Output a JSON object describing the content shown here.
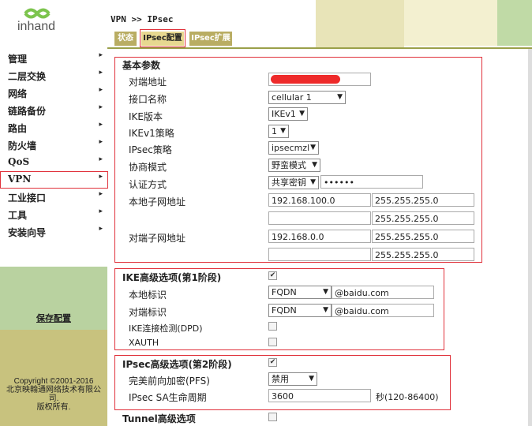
{
  "logo": {
    "text": "inhand"
  },
  "breadcrumb": "VPN >> IPsec",
  "tabs": [
    {
      "label": "状态"
    },
    {
      "label": "IPsec配置"
    },
    {
      "label": "IPsec扩展"
    }
  ],
  "menu": [
    {
      "label": "管理"
    },
    {
      "label": "二层交换"
    },
    {
      "label": "网络"
    },
    {
      "label": "链路备份"
    },
    {
      "label": "路由"
    },
    {
      "label": "防火墙"
    },
    {
      "label": "QoS"
    },
    {
      "label": "VPN"
    },
    {
      "label": "工业接口"
    },
    {
      "label": "工具"
    },
    {
      "label": "安装向导"
    }
  ],
  "menu_arrow": "▸",
  "save_config": "保存配置",
  "copyright": {
    "line1": "Copyright ©2001-2016",
    "line2": "北京映翰通网络技术有限公司.",
    "line3": "版权所有."
  },
  "basic": {
    "title": "基本参数",
    "peer_address_label": "对端地址",
    "interface_label": "接口名称",
    "interface_value": "cellular 1",
    "ike_version_label": "IKE版本",
    "ike_version_value": "IKEv1",
    "ikev1_policy_label": "IKEv1策略",
    "ikev1_policy_value": "1",
    "ipsec_policy_label": "IPsec策略",
    "ipsec_policy_value": "ipsecmzl",
    "negotiation_label": "协商模式",
    "negotiation_value": "野蛮模式",
    "auth_label": "认证方式",
    "auth_value": "共享密钥",
    "auth_secret": "••••••",
    "local_subnet_label": "本地子网地址",
    "local_subnet_ip": "192.168.100.0",
    "local_subnet_mask": "255.255.255.0",
    "local_subnet_mask2": "255.255.255.0",
    "remote_subnet_label": "对端子网地址",
    "remote_subnet_ip": "192.168.0.0",
    "remote_subnet_mask": "255.255.255.0",
    "remote_subnet_mask2": "255.255.255.0"
  },
  "ike": {
    "title": "IKE高级选项(第1阶段)",
    "local_id_label": "本地标识",
    "local_id_type": "FQDN",
    "local_id_value": "@baidu.com",
    "remote_id_label": "对端标识",
    "remote_id_type": "FQDN",
    "remote_id_value": "@baidu.com",
    "dpd_label": "IKE连接检测(DPD)",
    "xauth_label": "XAUTH",
    "enabled_checked": true
  },
  "ipsec": {
    "title": "IPsec高级选项(第2阶段)",
    "pfs_label": "完美前向加密(PFS)",
    "pfs_value": "禁用",
    "lifetime_label": "IPsec SA生命周期",
    "lifetime_value": "3600",
    "lifetime_unit": "秒(120-86400)"
  },
  "tunnel": {
    "title": "Tunnel高级选项"
  },
  "glyphs": {
    "chevron": "▼",
    "check": "✔"
  },
  "colors": {
    "highlight": "#e0303a",
    "tab": "#b9ad63",
    "save_bg": "#b9d2a0",
    "copy_bg": "#c8c27e"
  }
}
